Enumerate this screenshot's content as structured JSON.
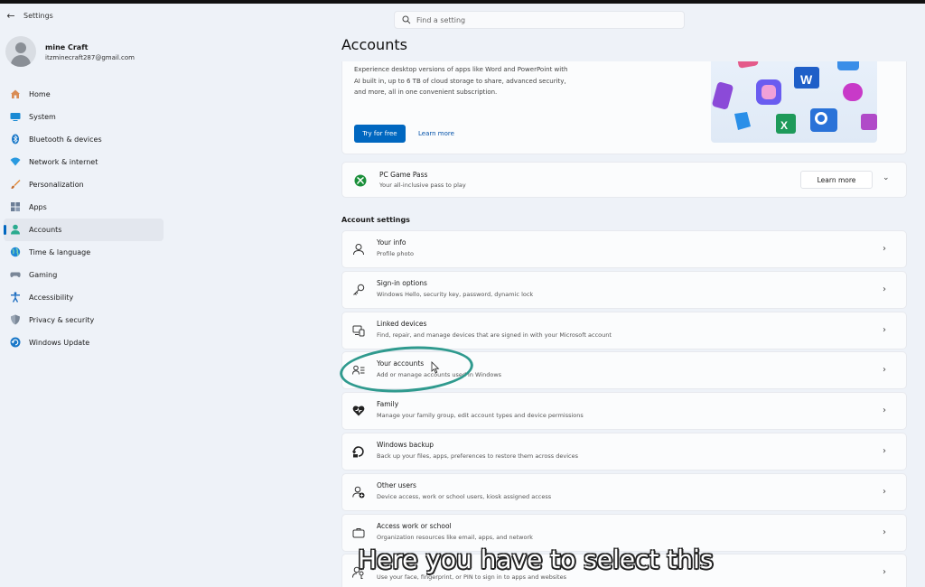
{
  "window": {
    "app_title": "Settings"
  },
  "search": {
    "placeholder": "Find a setting"
  },
  "profile": {
    "name": "mine Craft",
    "email": "itzminecraft287@gmail.com"
  },
  "sidebar": {
    "items": [
      {
        "label": "Home",
        "icon": "home-icon"
      },
      {
        "label": "System",
        "icon": "system-icon"
      },
      {
        "label": "Bluetooth & devices",
        "icon": "bluetooth-icon"
      },
      {
        "label": "Network & internet",
        "icon": "network-icon"
      },
      {
        "label": "Personalization",
        "icon": "brush-icon"
      },
      {
        "label": "Apps",
        "icon": "apps-icon"
      },
      {
        "label": "Accounts",
        "icon": "accounts-icon",
        "active": true
      },
      {
        "label": "Time & language",
        "icon": "globe-icon"
      },
      {
        "label": "Gaming",
        "icon": "gamepad-icon"
      },
      {
        "label": "Accessibility",
        "icon": "accessibility-icon"
      },
      {
        "label": "Privacy & security",
        "icon": "shield-icon"
      },
      {
        "label": "Windows Update",
        "icon": "update-icon"
      }
    ]
  },
  "main": {
    "title": "Accounts",
    "promo": {
      "text": "Experience desktop versions of apps like Word and PowerPoint with AI built in, up to 6 TB of cloud storage to share, advanced security, and more, all in one convenient subscription.",
      "try_label": "Try for free",
      "learn_label": "Learn more"
    },
    "gamepass": {
      "title": "PC Game Pass",
      "subtitle": "Your all-inclusive pass to play",
      "learn_label": "Learn more"
    },
    "section_title": "Account settings",
    "rows": [
      {
        "title": "Your info",
        "subtitle": "Profile photo",
        "icon": "person-icon"
      },
      {
        "title": "Sign-in options",
        "subtitle": "Windows Hello, security key, password, dynamic lock",
        "icon": "key-icon"
      },
      {
        "title": "Linked devices",
        "subtitle": "Find, repair, and manage devices that are signed in with your Microsoft account",
        "icon": "devices-icon"
      },
      {
        "title": "Your accounts",
        "subtitle": "Add or manage accounts used in Windows",
        "icon": "accounts-list-icon"
      },
      {
        "title": "Family",
        "subtitle": "Manage your family group, edit account types and device permissions",
        "icon": "family-heart-icon"
      },
      {
        "title": "Windows backup",
        "subtitle": "Back up your files, apps, preferences to restore them across devices",
        "icon": "backup-icon"
      },
      {
        "title": "Other users",
        "subtitle": "Device access, work or school users, kiosk assigned access",
        "icon": "add-user-icon"
      },
      {
        "title": "Access work or school",
        "subtitle": "Organization resources like email, apps, and network",
        "icon": "briefcase-icon"
      },
      {
        "title": "",
        "subtitle": "Use your face, fingerprint, or PIN to sign in to apps and websites",
        "icon": "passkey-icon"
      }
    ]
  },
  "caption": "Here you have to select this",
  "colors": {
    "accent": "#0067c0",
    "highlight": "#2f9a8e",
    "background": "#eef2f8"
  }
}
